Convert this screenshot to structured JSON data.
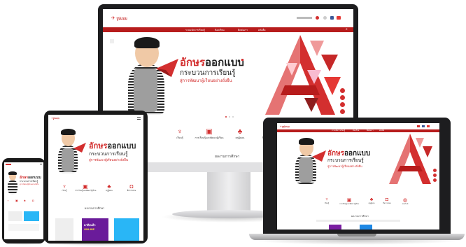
{
  "site": {
    "logo_text": "รูปแบบ",
    "headline_red": "อักษร",
    "headline_dark": "ออกแบบ",
    "subhead": "กระบวนการเรียนรู้",
    "tagline": "สู่การพัฒนาผู้เรียนอย่างยั่งยืน",
    "nav": [
      "ระบบจัดการเรียนรู้",
      "ห้องเรียน",
      "ติดต่อเรา",
      "คลังสื่อ"
    ],
    "features": [
      {
        "icon": "rocket-icon",
        "label": "เรียนรู้"
      },
      {
        "icon": "book-icon",
        "label": "การเรียนรู้และพัฒนาผู้เรียน"
      },
      {
        "icon": "tree-icon",
        "label": "ครูผู้สอน"
      },
      {
        "icon": "box-icon",
        "label": "สื่อการสอน"
      },
      {
        "icon": "globe-icon",
        "label": "ออนไลน์"
      }
    ],
    "section_title": "ผลงานการศึกษา",
    "tablet_banner": "มาถึงแล้ว",
    "tablet_banner2": "ONLINE"
  },
  "colors": {
    "brand_red": "#d32f2f",
    "dark_red": "#b71c1c",
    "accent_pink": "#e57373",
    "frame": "#1d1d1f"
  }
}
